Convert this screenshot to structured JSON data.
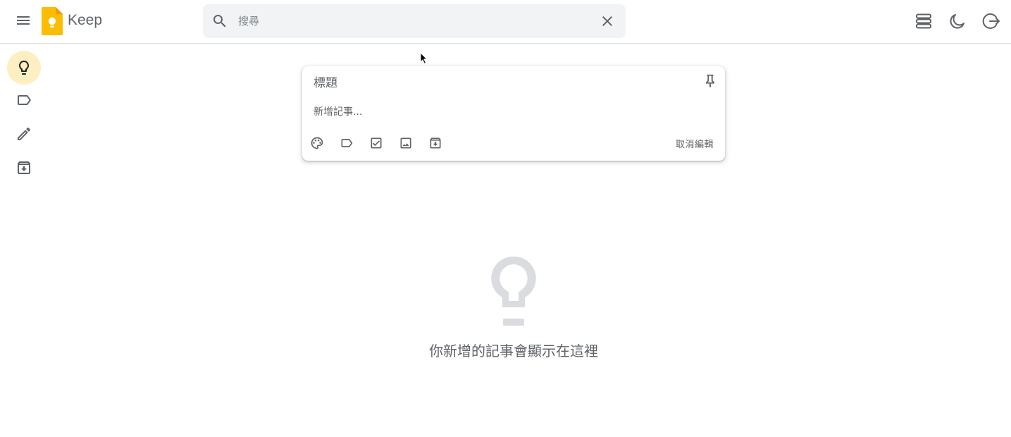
{
  "header": {
    "app_name": "Keep",
    "menu_icon": "hamburger-menu-icon",
    "logo_icon": "keep-logo-icon",
    "search": {
      "placeholder": "搜尋",
      "value": "",
      "icon": "search-icon",
      "clear_icon": "close-icon"
    },
    "actions": [
      {
        "name": "list-view-icon"
      },
      {
        "name": "dark-mode-icon"
      },
      {
        "name": "logout-icon"
      }
    ]
  },
  "sidebar": {
    "items": [
      {
        "name": "notes",
        "icon": "lightbulb-icon",
        "active": true
      },
      {
        "name": "labels",
        "icon": "label-icon",
        "active": false
      },
      {
        "name": "edit-labels",
        "icon": "pencil-icon",
        "active": false
      },
      {
        "name": "archive",
        "icon": "archive-icon",
        "active": false
      }
    ]
  },
  "composer": {
    "title_placeholder": "標題",
    "body_placeholder": "新增記事...",
    "pin_icon": "pin-icon",
    "tools": [
      "palette-icon",
      "label-icon",
      "checkbox-icon",
      "image-icon",
      "archive-icon"
    ],
    "cancel_label": "取消編輯"
  },
  "empty_state": {
    "icon": "lightbulb-icon",
    "message": "你新增的記事會顯示在這裡"
  },
  "colors": {
    "accent": "#feefc3",
    "logo_yellow": "#fbbc04",
    "icon_gray": "#5f6368",
    "empty_icon_gray": "#dadce0",
    "search_bg": "#f1f3f4"
  }
}
